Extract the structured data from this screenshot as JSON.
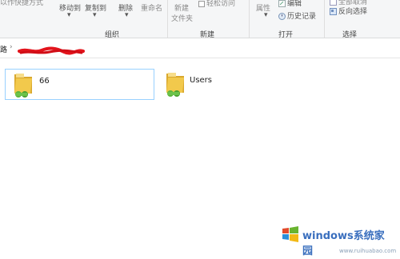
{
  "ribbon": {
    "top_left_button": "以作快捷方式",
    "move_to": "移动到",
    "copy_to": "复制到",
    "delete": "删除",
    "rename": "重命名",
    "new_item": "新建",
    "new_folder": "文件夹",
    "easy_access": "轻松访问",
    "properties": "属性",
    "edit": "编辑",
    "history": "历史记录",
    "select_none": "全部取消",
    "invert_selection": "反向选择",
    "groups": {
      "organize": "组织",
      "new": "新建",
      "open": "打开",
      "select": "选择"
    }
  },
  "address": {
    "prefix": "路",
    "separator": "›"
  },
  "files": [
    {
      "name": "66",
      "selected": true
    },
    {
      "name": "Users",
      "selected": false
    }
  ],
  "watermark": {
    "brand": "windows系统家园",
    "url": "www.ruihuabao.com"
  },
  "colors": {
    "folder": "#f2c94c",
    "folder_dark": "#d9a82e",
    "share_green": "#5bb53b",
    "selection_border": "#99d1ff"
  }
}
